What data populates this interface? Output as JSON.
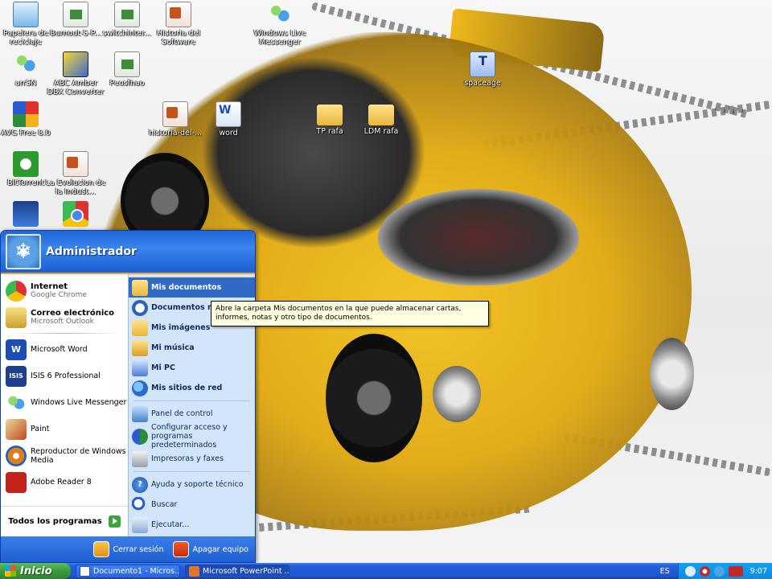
{
  "desktop": {
    "icons": [
      {
        "label": "Papelera de reciclaje",
        "icon": "recycle-bin-icon"
      },
      {
        "label": "Burnout-S-P...",
        "icon": "image-file-icon"
      },
      {
        "label": "switchinter...",
        "icon": "image-file-icon"
      },
      {
        "label": "Historia del Software",
        "icon": "powerpoint-file-icon"
      },
      {
        "label": "Windows Live Messenger",
        "icon": "messenger-icon"
      },
      {
        "label": "arrSN",
        "icon": "messenger-icon"
      },
      {
        "label": "ABC Amber DBX Converter",
        "icon": "abc-amber-icon"
      },
      {
        "label": "Peosfhao",
        "icon": "image-file-icon"
      },
      {
        "label": "spaceage",
        "icon": "font-file-icon"
      },
      {
        "label": "AVG Free 8.0",
        "icon": "avg-icon"
      },
      {
        "label": "historia-del-...",
        "icon": "powerpoint-file-icon"
      },
      {
        "label": "word",
        "icon": "word-file-icon"
      },
      {
        "label": "TP rafa",
        "icon": "folder-icon"
      },
      {
        "label": "LDM rafa",
        "icon": "folder-icon"
      },
      {
        "label": "BitTorrent",
        "icon": "bittorrent-icon"
      },
      {
        "label": "La Evolucion de la Indust...",
        "icon": "powerpoint-file-icon"
      },
      {
        "label": "",
        "icon": "seetech-icon"
      },
      {
        "label": "",
        "icon": "chrome-icon"
      }
    ]
  },
  "start_menu": {
    "user": "Administrador",
    "pinned": [
      {
        "title": "Internet",
        "subtitle": "Google Chrome"
      },
      {
        "title": "Correo electrónico",
        "subtitle": "Microsoft Outlook"
      }
    ],
    "recent": [
      "Microsoft Word",
      "ISIS 6 Professional",
      "Windows Live Messenger",
      "Paint",
      "Reproductor de Windows Media",
      "Adobe Reader 8"
    ],
    "all_programs": "Todos los programas",
    "places": [
      "Mis documentos",
      "Documentos recientes",
      "Mis imágenes",
      "Mi música",
      "Mi PC",
      "Mis sitios de red"
    ],
    "settings": [
      "Panel de control",
      "Configurar acceso y programas predeterminados",
      "Impresoras y faxes"
    ],
    "tools": [
      "Ayuda y soporte técnico",
      "Buscar",
      "Ejecutar..."
    ],
    "logoff": "Cerrar sesión",
    "shutdown": "Apagar equipo"
  },
  "tooltip": "Abre la carpeta Mis documentos en la que puede almacenar cartas, informes, notas y otro tipo de documentos.",
  "taskbar": {
    "start_label": "Inicio",
    "tasks": [
      {
        "label": "Documento1 - Micros..."
      },
      {
        "label": "Microsoft PowerPoint ..."
      }
    ],
    "language": "ES",
    "clock": "9:07"
  }
}
